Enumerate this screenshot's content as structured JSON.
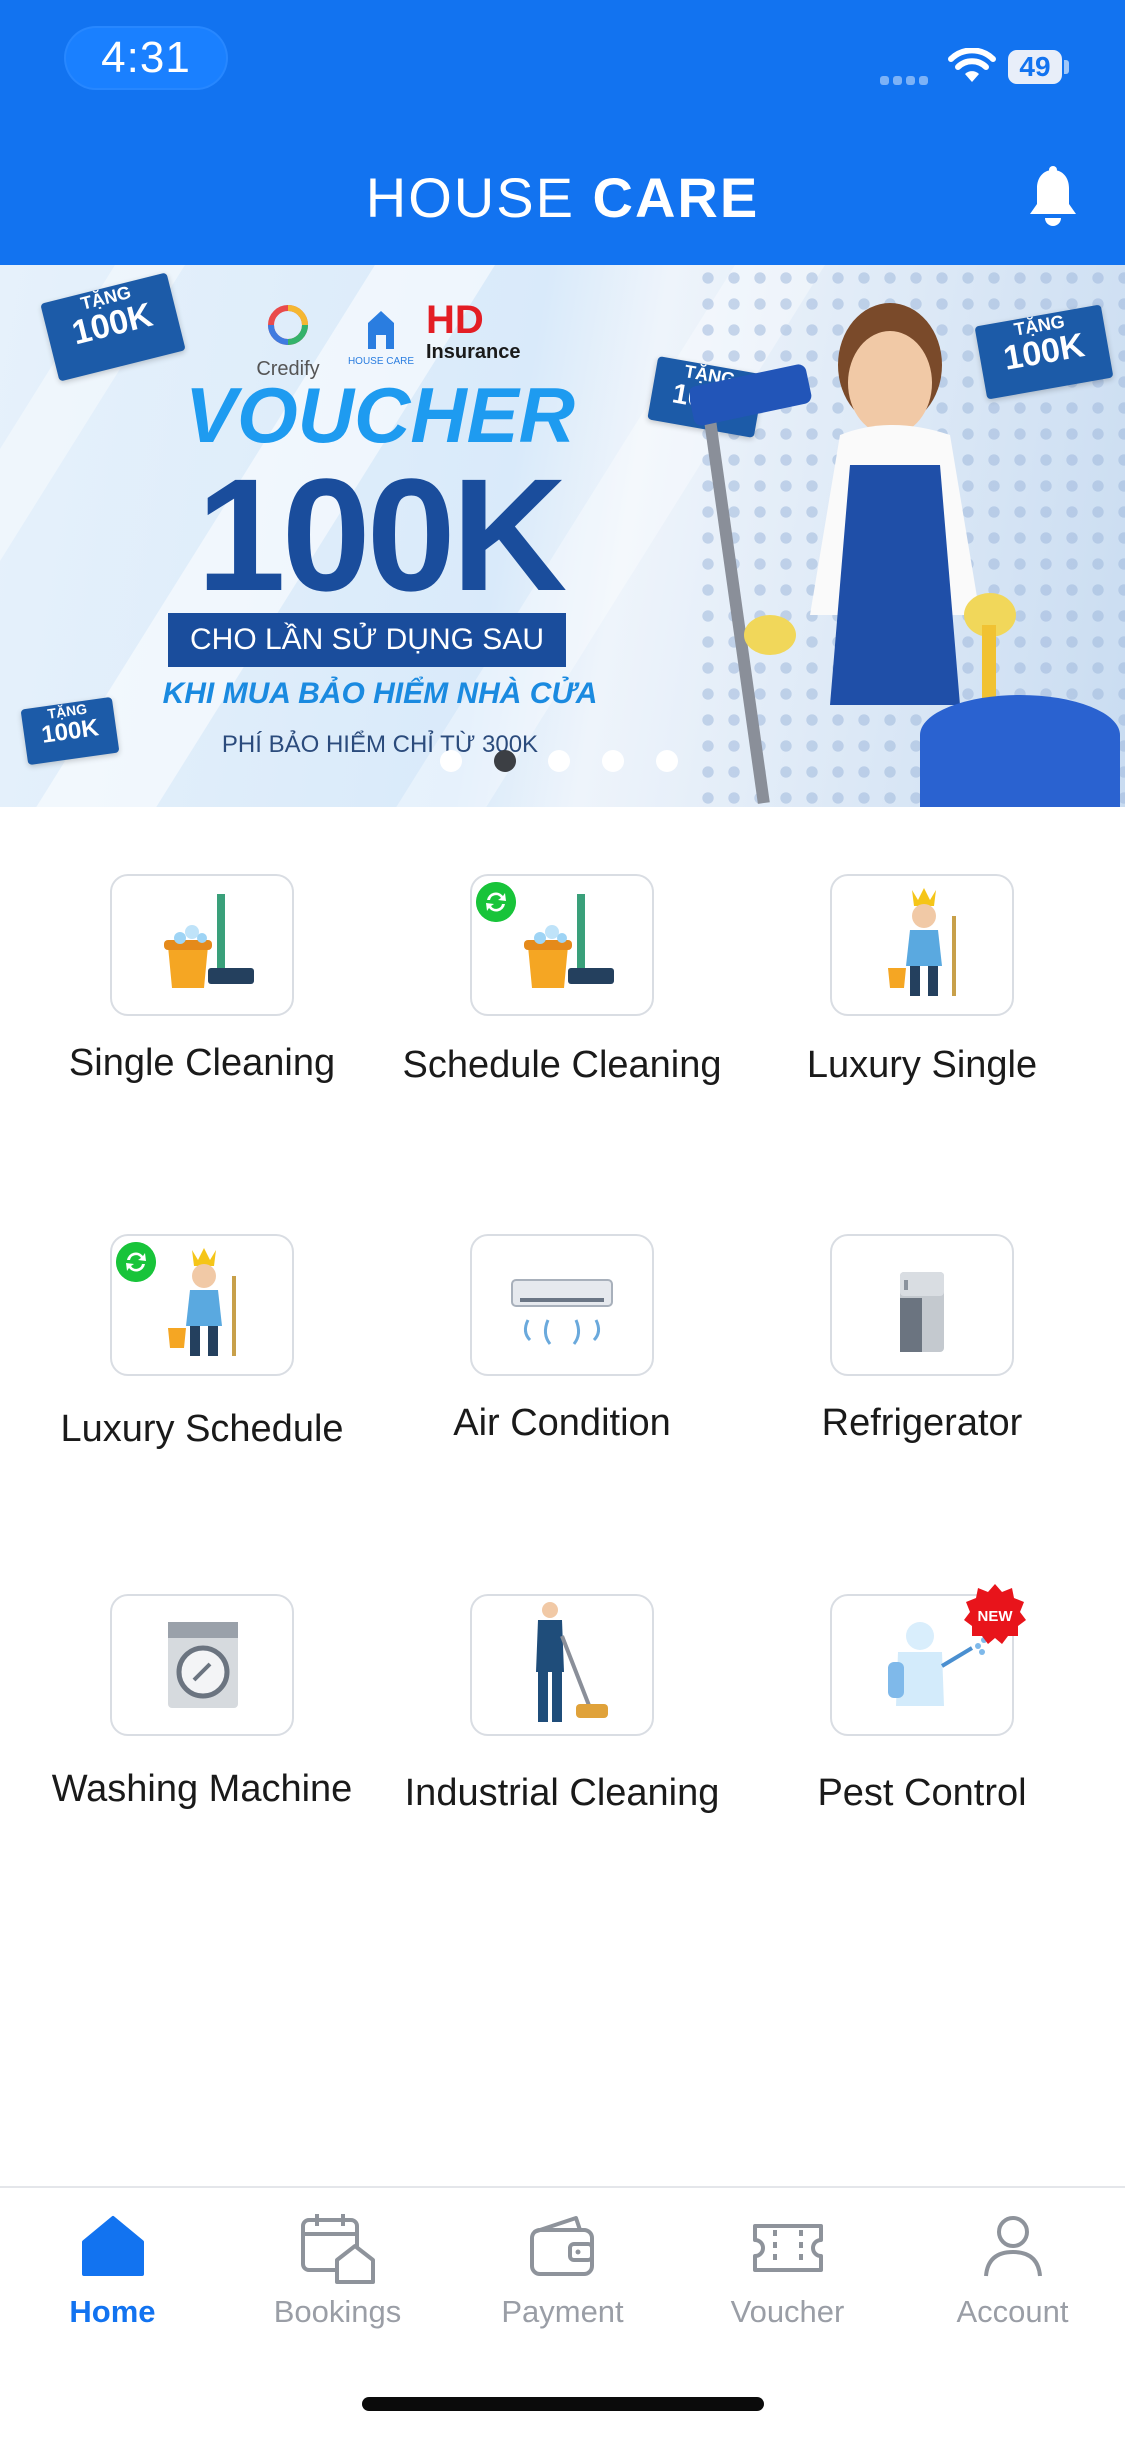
{
  "status_bar": {
    "time": "4:31",
    "battery": "49"
  },
  "header": {
    "brand_light": "HOUSE",
    "brand_bold": "CARE"
  },
  "banner": {
    "ticket_top": "TẶNG",
    "ticket_value": "100K",
    "logo_credify": "Credify",
    "logo_housecare": "HOUSE CARE",
    "logo_hd": "HD",
    "logo_insurance": "Insurance",
    "headline": "VOUCHER",
    "amount": "100K",
    "box_text": "CHO LẦN SỬ DỤNG SAU",
    "line": "KHI MUA BẢO HIỂM NHÀ CỬA",
    "small": "PHÍ BẢO HIỂM CHỈ TỪ 300K",
    "slide_count": 5,
    "active_slide": 2
  },
  "services": [
    {
      "label": "Single Cleaning",
      "icon": "cleaning-bucket-icon"
    },
    {
      "label": "Schedule Cleaning",
      "icon": "cleaning-bucket-icon",
      "badge": "sync-icon"
    },
    {
      "label": "Luxury Single",
      "icon": "crowned-cleaner-icon"
    },
    {
      "label": "Luxury Schedule",
      "icon": "crowned-cleaner-icon",
      "badge": "sync-icon"
    },
    {
      "label": "Air Condition",
      "icon": "air-conditioner-icon"
    },
    {
      "label": "Refrigerator",
      "icon": "refrigerator-icon"
    },
    {
      "label": "Washing Machine",
      "icon": "washing-machine-icon"
    },
    {
      "label": "Industrial Cleaning",
      "icon": "floor-polisher-worker-icon"
    },
    {
      "label": "Pest Control",
      "icon": "pest-sprayer-icon",
      "badge_text": "NEW"
    }
  ],
  "tabs": [
    {
      "label": "Home",
      "icon": "home-icon",
      "active": true
    },
    {
      "label": "Bookings",
      "icon": "calendar-home-icon"
    },
    {
      "label": "Payment",
      "icon": "wallet-icon"
    },
    {
      "label": "Voucher",
      "icon": "ticket-icon"
    },
    {
      "label": "Account",
      "icon": "person-icon"
    }
  ],
  "colors": {
    "primary": "#1273f0",
    "sync_badge": "#18c43a",
    "new_badge": "#e8141b"
  }
}
